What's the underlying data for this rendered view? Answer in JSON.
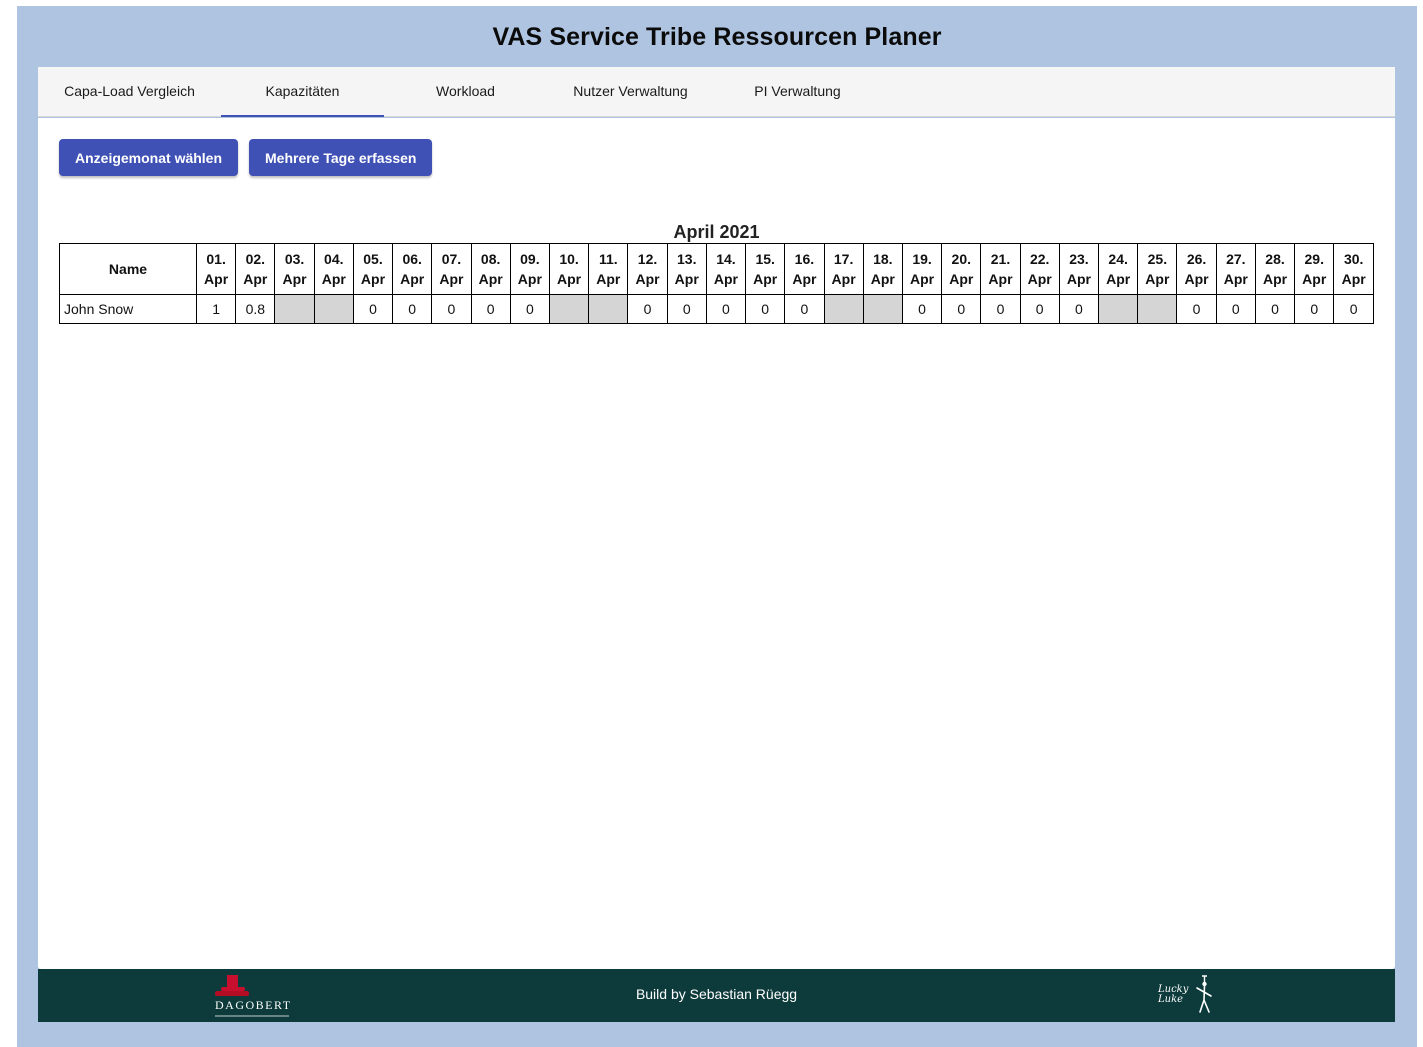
{
  "app": {
    "title": "VAS Service Tribe Ressourcen Planer"
  },
  "tabs": [
    {
      "label": "Capa-Load Vergleich",
      "active": false
    },
    {
      "label": "Kapazitäten",
      "active": true
    },
    {
      "label": "Workload",
      "active": false
    },
    {
      "label": "Nutzer Verwaltung",
      "active": false
    },
    {
      "label": "PI Verwaltung",
      "active": false
    }
  ],
  "toolbar": {
    "select_month_label": "Anzeigemonat wählen",
    "multi_days_label": "Mehrere Tage erfassen"
  },
  "table": {
    "month_title": "April 2021",
    "name_header": "Name",
    "day_headers": [
      {
        "day": "01.",
        "month": "Apr"
      },
      {
        "day": "02.",
        "month": "Apr"
      },
      {
        "day": "03.",
        "month": "Apr"
      },
      {
        "day": "04.",
        "month": "Apr"
      },
      {
        "day": "05.",
        "month": "Apr"
      },
      {
        "day": "06.",
        "month": "Apr"
      },
      {
        "day": "07.",
        "month": "Apr"
      },
      {
        "day": "08.",
        "month": "Apr"
      },
      {
        "day": "09.",
        "month": "Apr"
      },
      {
        "day": "10.",
        "month": "Apr"
      },
      {
        "day": "11.",
        "month": "Apr"
      },
      {
        "day": "12.",
        "month": "Apr"
      },
      {
        "day": "13.",
        "month": "Apr"
      },
      {
        "day": "14.",
        "month": "Apr"
      },
      {
        "day": "15.",
        "month": "Apr"
      },
      {
        "day": "16.",
        "month": "Apr"
      },
      {
        "day": "17.",
        "month": "Apr"
      },
      {
        "day": "18.",
        "month": "Apr"
      },
      {
        "day": "19.",
        "month": "Apr"
      },
      {
        "day": "20.",
        "month": "Apr"
      },
      {
        "day": "21.",
        "month": "Apr"
      },
      {
        "day": "22.",
        "month": "Apr"
      },
      {
        "day": "23.",
        "month": "Apr"
      },
      {
        "day": "24.",
        "month": "Apr"
      },
      {
        "day": "25.",
        "month": "Apr"
      },
      {
        "day": "26.",
        "month": "Apr"
      },
      {
        "day": "27.",
        "month": "Apr"
      },
      {
        "day": "28.",
        "month": "Apr"
      },
      {
        "day": "29.",
        "month": "Apr"
      },
      {
        "day": "30.",
        "month": "Apr"
      }
    ],
    "rows": [
      {
        "name": "John Snow",
        "values": [
          "1",
          "0.8",
          "",
          "",
          "0",
          "0",
          "0",
          "0",
          "0",
          "",
          "",
          "0",
          "0",
          "0",
          "0",
          "0",
          "",
          "",
          "0",
          "0",
          "0",
          "0",
          "0",
          "",
          "",
          "0",
          "0",
          "0",
          "0",
          "0"
        ],
        "weekend": [
          false,
          false,
          true,
          true,
          false,
          false,
          false,
          false,
          false,
          true,
          true,
          false,
          false,
          false,
          false,
          false,
          true,
          true,
          false,
          false,
          false,
          false,
          false,
          true,
          true,
          false,
          false,
          false,
          false,
          false
        ]
      }
    ]
  },
  "footer": {
    "credit": "Build by Sebastian Rüegg",
    "logo_left_icon": "dagobert-logo",
    "logo_left_text": "DAGOBERT",
    "logo_right_icon": "lucky-luke-logo",
    "logo_right_text": "Lucky Luke"
  },
  "colors": {
    "frame_background": "#afc4e1",
    "primary": "#3f51b5",
    "footer_background": "#0d3a3a",
    "weekend_cell": "#d5d5d5"
  }
}
